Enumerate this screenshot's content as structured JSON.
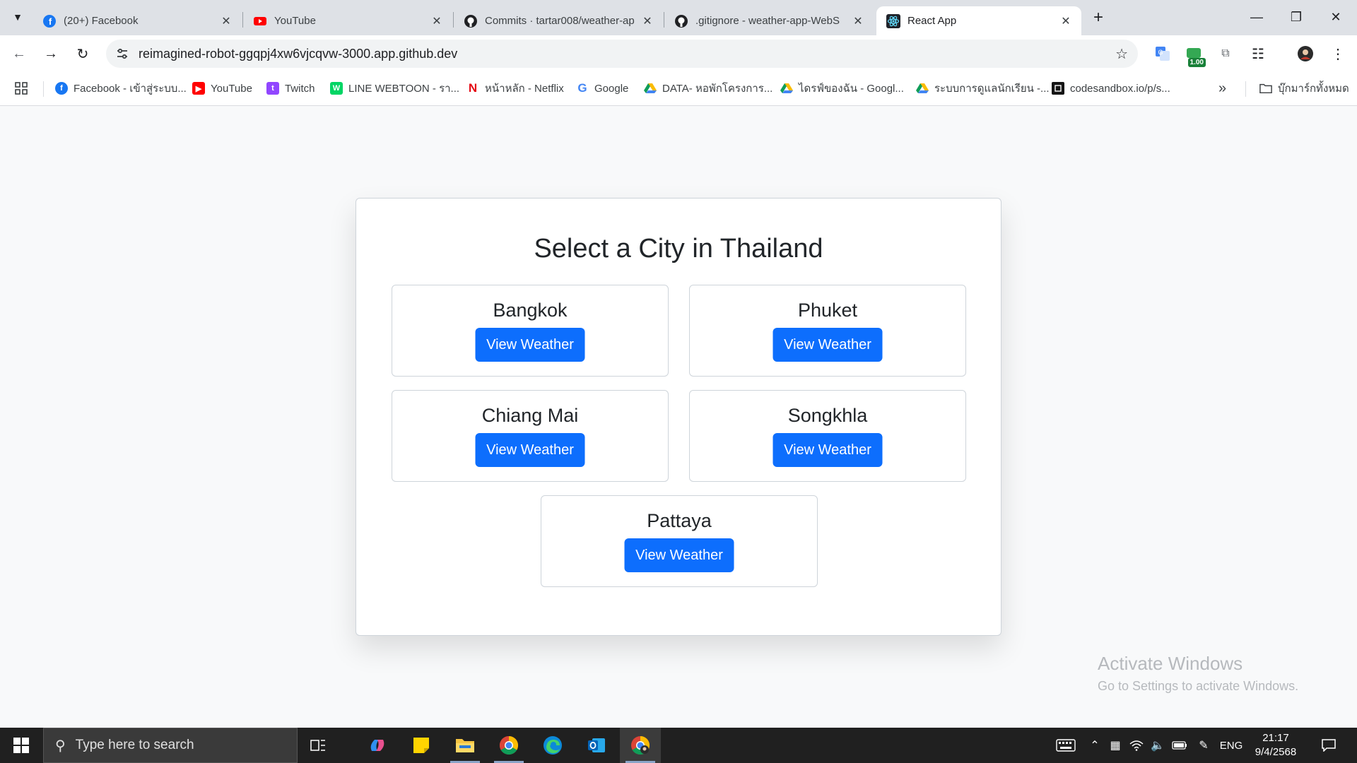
{
  "browser": {
    "tabs": [
      {
        "title": "(20+) Facebook",
        "icon": "facebook-icon",
        "color": "#1877f2"
      },
      {
        "title": "YouTube",
        "icon": "youtube-icon",
        "color": "#ff0000"
      },
      {
        "title": "Commits · tartar008/weather-ap",
        "icon": "github-icon",
        "color": "#202124"
      },
      {
        "title": ".gitignore - weather-app-WebS",
        "icon": "github-icon",
        "color": "#202124"
      },
      {
        "title": "React App",
        "icon": "react-icon",
        "color": "#20232a",
        "active": true
      }
    ],
    "url": "reimagined-robot-ggqpj4xw6vjcqvw-3000.app.github.dev",
    "extension_badge": "1.00",
    "bookmarks": [
      {
        "label": "Facebook - เข้าสู่ระบบ...",
        "icon": "facebook-icon",
        "color": "#1877f2"
      },
      {
        "label": "YouTube",
        "icon": "youtube-icon",
        "color": "#ff0000"
      },
      {
        "label": "Twitch",
        "icon": "twitch-icon",
        "color": "#9146ff"
      },
      {
        "label": "LINE WEBTOON - รา...",
        "icon": "webtoon-icon",
        "color": "#00d564"
      },
      {
        "label": "หน้าหลัก - Netflix",
        "icon": "netflix-icon",
        "color": "#e50914"
      },
      {
        "label": "Google",
        "icon": "google-icon",
        "color": "#4285f4"
      },
      {
        "label": "DATA- หอพักโครงการ...",
        "icon": "drive-icon",
        "color": "#fbbc04"
      },
      {
        "label": "ไดรฟ์ของฉัน - Googl...",
        "icon": "drive-icon",
        "color": "#fbbc04"
      },
      {
        "label": "ระบบการดูแลนักเรียน -...",
        "icon": "drive-icon",
        "color": "#fbbc04"
      },
      {
        "label": "codesandbox.io/p/s...",
        "icon": "codesandbox-icon",
        "color": "#151515"
      }
    ],
    "all_bookmarks_label": "บุ๊กมาร์กทั้งหมด"
  },
  "page": {
    "title": "Select a City in Thailand",
    "button_label": "View Weather",
    "button_color": "#0d6efd",
    "cities": [
      "Bangkok",
      "Phuket",
      "Chiang Mai",
      "Songkhla",
      "Pattaya"
    ]
  },
  "watermark": {
    "line1": "Activate Windows",
    "line2": "Go to Settings to activate Windows."
  },
  "taskbar": {
    "search_placeholder": "Type here to search",
    "language": "ENG",
    "time": "21:17",
    "date": "9/4/2568"
  }
}
